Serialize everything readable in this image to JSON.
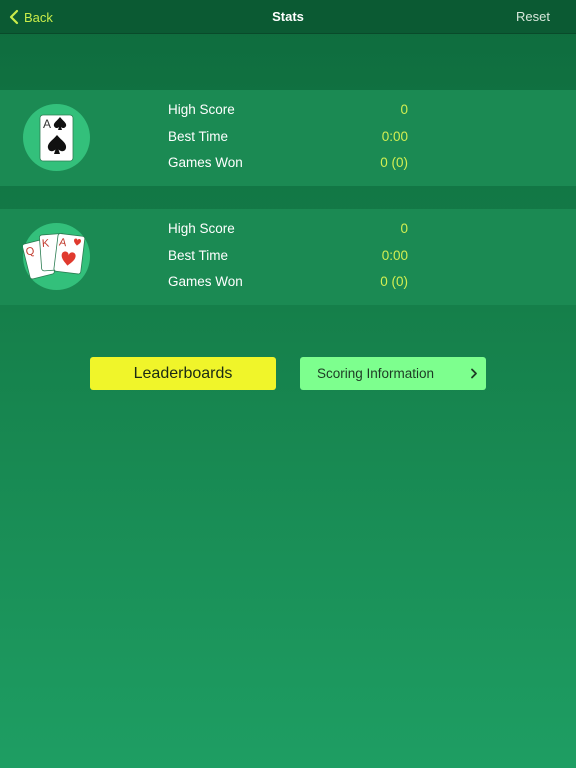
{
  "nav": {
    "back_label": "Back",
    "title": "Stats",
    "reset_label": "Reset"
  },
  "stats": [
    {
      "mode_icon": "single-ace-card-icon",
      "rows": [
        {
          "label": "High Score",
          "value": "0"
        },
        {
          "label": "Best Time",
          "value": "0:00"
        },
        {
          "label": "Games Won",
          "value": "0 (0)"
        }
      ]
    },
    {
      "mode_icon": "three-cards-fan-icon",
      "rows": [
        {
          "label": "High Score",
          "value": "0"
        },
        {
          "label": "Best Time",
          "value": "0:00"
        },
        {
          "label": "Games Won",
          "value": "0 (0)"
        }
      ]
    }
  ],
  "buttons": {
    "leaderboards": "Leaderboards",
    "scoring": "Scoring Information"
  },
  "colors": {
    "accent_yellow": "#f0f52a",
    "accent_green": "#7dff8e",
    "value_text": "#d2ef52",
    "icon_circle": "#33c07b"
  }
}
